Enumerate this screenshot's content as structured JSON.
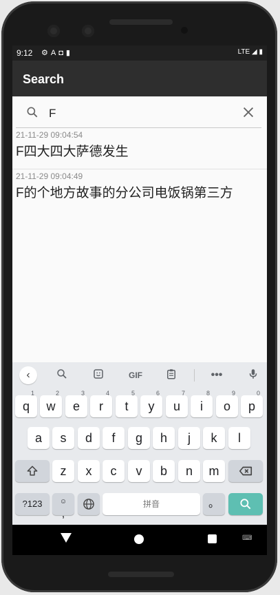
{
  "status": {
    "time": "9:12",
    "network": "LTE",
    "left_icons": [
      "settings-icon",
      "text-icon",
      "shield-icon",
      "sd-card-icon"
    ]
  },
  "appbar": {
    "title": "Search"
  },
  "search": {
    "value": "F",
    "placeholder": ""
  },
  "results": [
    {
      "timestamp": "21-11-29 09:04:54",
      "text": "F四大四大萨德发生"
    },
    {
      "timestamp": "21-11-29 09:04:49",
      "text": "F的个地方故事的分公司电饭锅第三方"
    }
  ],
  "keyboard": {
    "toolbar": [
      "back-icon",
      "search-icon",
      "sticker-icon",
      "gif-icon",
      "clipboard-icon",
      "more-icon",
      "mic-icon"
    ],
    "gif_label": "GIF",
    "row1": [
      {
        "k": "q",
        "h": "1"
      },
      {
        "k": "w",
        "h": "2"
      },
      {
        "k": "e",
        "h": "3"
      },
      {
        "k": "r",
        "h": "4"
      },
      {
        "k": "t",
        "h": "5"
      },
      {
        "k": "y",
        "h": "6"
      },
      {
        "k": "u",
        "h": "7"
      },
      {
        "k": "i",
        "h": "8"
      },
      {
        "k": "o",
        "h": "9"
      },
      {
        "k": "p",
        "h": "0"
      }
    ],
    "row2": [
      "a",
      "s",
      "d",
      "f",
      "g",
      "h",
      "j",
      "k",
      "l"
    ],
    "row3": [
      "z",
      "x",
      "c",
      "v",
      "b",
      "n",
      "m"
    ],
    "sym_label": "?123",
    "comma_label": ",",
    "space_label": "拼音",
    "period_label": "。"
  }
}
